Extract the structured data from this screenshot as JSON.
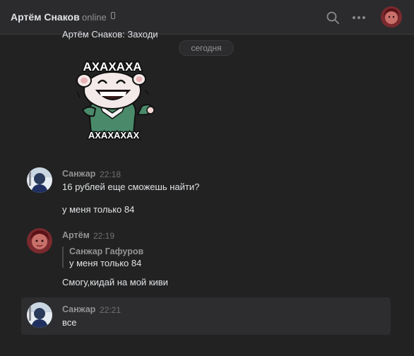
{
  "header": {
    "name": "Артём Снаков",
    "status": "online"
  },
  "chat": {
    "clipped_text": "Артём Снаков: Заходи",
    "date_label": "сегодня",
    "sticker": {
      "top_text": "АХАХАХА",
      "bottom_text": "АХАХАХАХ"
    },
    "messages": [
      {
        "author": "Санжар",
        "time": "22:18",
        "lines": [
          "16 рублей еще сможешь найти?",
          "у меня только 84"
        ]
      },
      {
        "author": "Артём",
        "time": "22:19",
        "reply": {
          "author": "Санжар Гафуров",
          "text": "у меня только 84"
        },
        "lines": [
          "Смогу,кидай на мой киви"
        ]
      },
      {
        "author": "Санжар",
        "time": "22:21",
        "lines": [
          "все"
        ]
      }
    ]
  },
  "colors": {
    "background": "#222222",
    "header_bg": "#2b2b2d",
    "text": "#e1e3e6",
    "muted": "#939393",
    "highlight_bg": "#2d2d2f"
  }
}
